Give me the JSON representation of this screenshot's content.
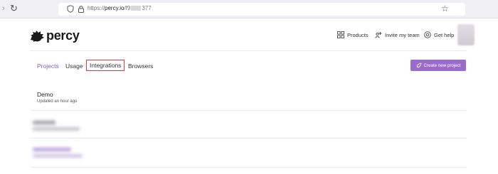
{
  "browser": {
    "url_prefix": "https://",
    "url_host": "percy.io",
    "url_path": "/f9",
    "url_suffix": "377"
  },
  "header": {
    "brand": "percy",
    "products_label": "Products",
    "invite_label": "Invite my team",
    "help_label": "Get help"
  },
  "tabs": [
    {
      "label": "Projects",
      "active": true
    },
    {
      "label": "Usage"
    },
    {
      "label": "Integrations",
      "highlighted": true
    },
    {
      "label": "Browsers"
    }
  ],
  "create_project_label": "Create new project",
  "projects": [
    {
      "name": "Demo",
      "updated": "Updated an hour ago"
    }
  ],
  "colors": {
    "accent": "#9b6bcc",
    "active_tab": "#7a5fb8",
    "highlight_box": "#e23b3b"
  }
}
